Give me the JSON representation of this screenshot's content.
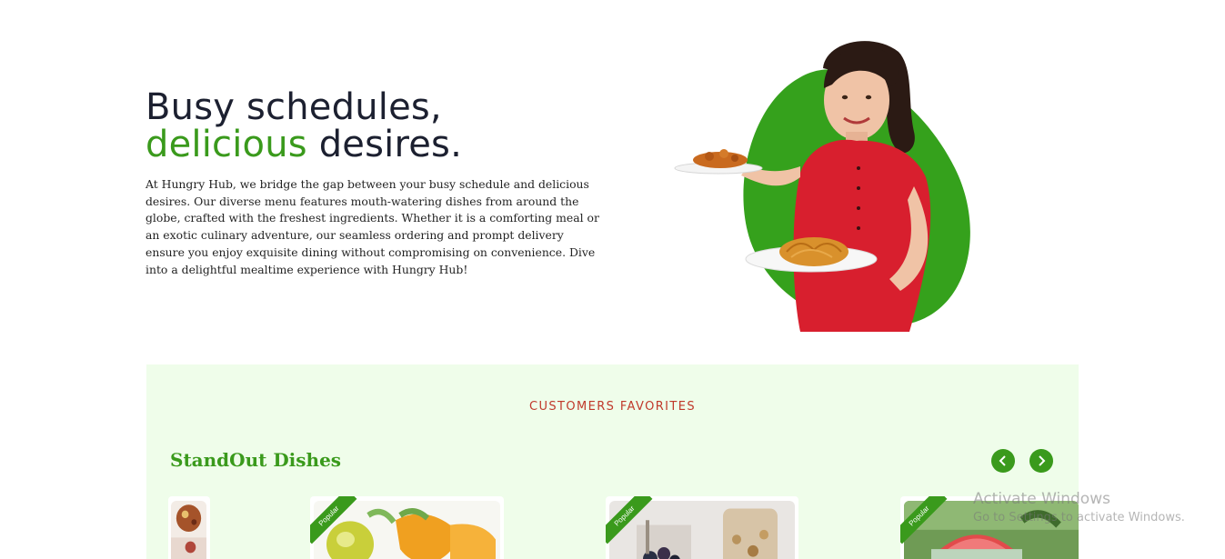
{
  "hero": {
    "headline_line1": "Busy schedules,",
    "headline_green": "delicious",
    "headline_rest": " desires.",
    "description": "At Hungry Hub, we bridge the gap between your busy schedule and delicious desires. Our diverse menu features mouth-watering dishes from around the globe, crafted with the freshest ingredients. Whether it is a comforting meal or an exotic culinary adventure, our seamless ordering and prompt delivery ensure you enjoy exquisite dining without compromising on convenience. Dive into a delightful mealtime experience with Hungry Hub!"
  },
  "favorites": {
    "eyebrow": "CUSTOMERS FAVORITES",
    "title": "StandOut Dishes",
    "prev_icon": "chevron-left-icon",
    "next_icon": "chevron-right-icon",
    "cards": [
      {
        "badge": ""
      },
      {
        "badge": "Popular"
      },
      {
        "badge": "Popular"
      },
      {
        "badge": "Popular"
      }
    ]
  },
  "watermark": {
    "title": "Activate Windows",
    "subtitle": "Go to Settings to activate Windows."
  },
  "colors": {
    "brand_green": "#3a9a1c",
    "accent_red": "#c0392b",
    "section_bg": "#effdea",
    "headline_dark": "#1c2030"
  }
}
